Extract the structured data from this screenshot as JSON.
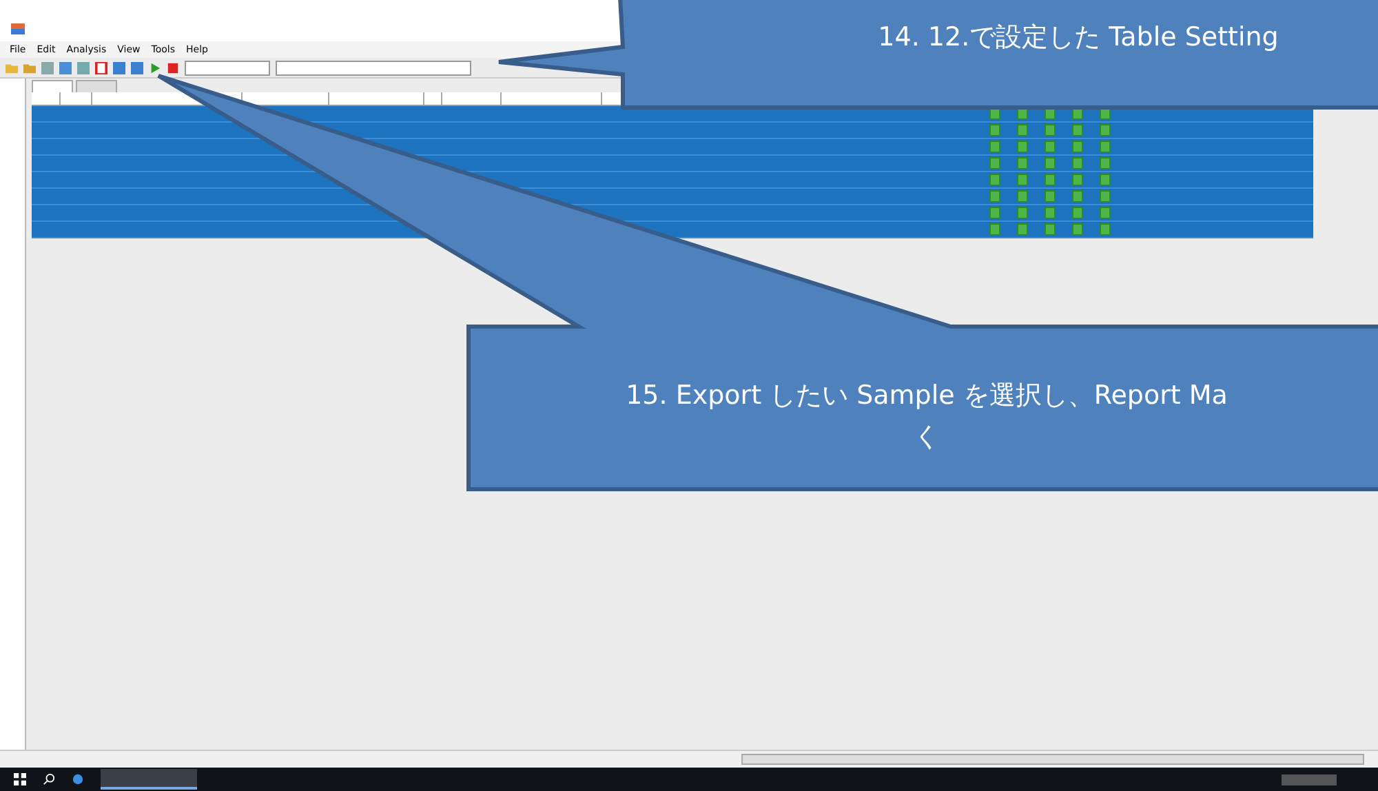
{
  "window": {
    "menu": [
      "File",
      "Edit",
      "Analysis",
      "View",
      "Tools",
      "Help"
    ]
  },
  "table": {
    "rows": [
      {
        "selected": true
      },
      {
        "selected": true
      },
      {
        "selected": true
      },
      {
        "selected": true
      },
      {
        "selected": true
      },
      {
        "selected": true
      },
      {
        "selected": true
      },
      {
        "selected": true
      }
    ]
  },
  "callouts": [
    {
      "kind": "right",
      "lines": [
        "14. 12.で設定した Table Setting"
      ]
    },
    {
      "kind": "below",
      "lines": [
        "15. Export したい Sample を選択し、Report Ma",
        "く"
      ]
    }
  ]
}
